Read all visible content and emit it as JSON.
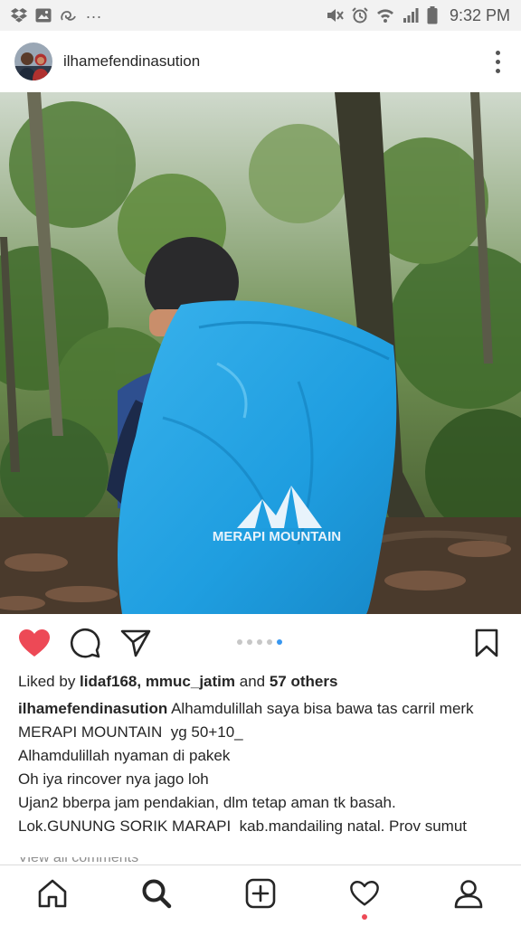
{
  "status_bar": {
    "time": "9:32 PM",
    "overflow": "...",
    "left_icons": [
      "dropbox-icon",
      "gallery-icon",
      "app-icon"
    ],
    "right_icons": [
      "mute-icon",
      "alarm-icon",
      "wifi-icon",
      "signal-icon",
      "battery-icon"
    ]
  },
  "post": {
    "username": "ilhamefendinasution",
    "photo_logo_text": "MERAPI MOUNTAIN",
    "carousel": {
      "count": 5,
      "active_index": 4
    },
    "liked": true,
    "likes": {
      "prefix": "Liked by ",
      "user1": "lidaf168",
      "sep": ", ",
      "user2": "mmuc_jatim",
      "and": " and ",
      "others": "57 others"
    },
    "caption": {
      "username": "ilhamefendinasution",
      "first_line": " Alhamdulillah saya bisa bawa tas carril merk MERAPI MOUNTAIN  yg 50+10_",
      "lines": [
        "Alhamdulillah nyaman di pakek",
        "Oh iya rincover nya jago loh",
        "Ujan2 bberpa jam pendakian, dlm tetap aman tk basah.",
        "Lok.GUNUNG SORIK MARAPI  kab.mandailing natal. Prov sumut"
      ]
    },
    "comments_peek": "View all comments"
  },
  "colors": {
    "like_red": "#ed4956",
    "carousel_active": "#3897f0",
    "text": "#262626"
  },
  "bottom_nav": [
    "home-icon",
    "search-icon",
    "add-post-icon",
    "activity-heart-icon",
    "profile-icon"
  ]
}
